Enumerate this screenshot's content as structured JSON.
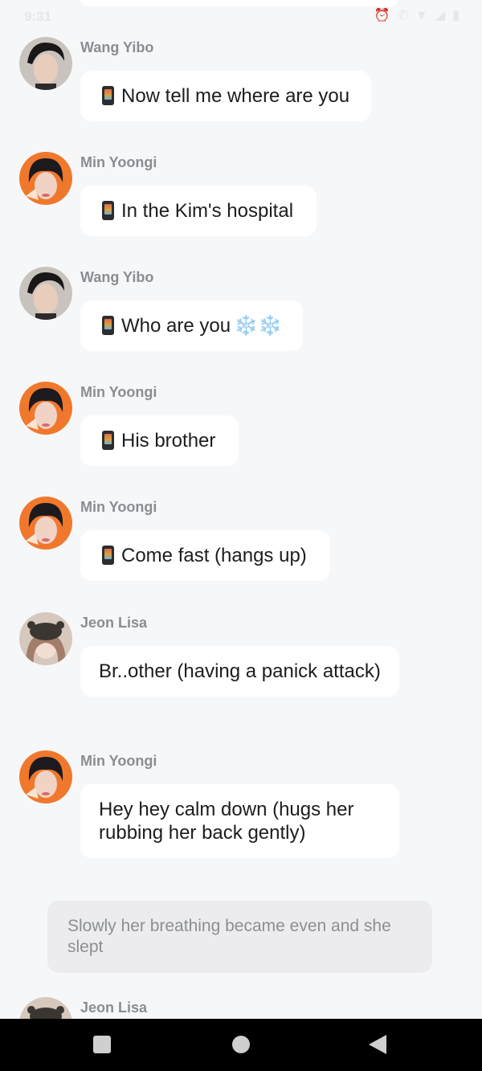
{
  "status_bar": {
    "time": "9:31",
    "icons": [
      "alarm-icon",
      "call-icon",
      "wifi-icon",
      "signal-icon",
      "battery-icon"
    ]
  },
  "messages": [
    {
      "sender": "Wang Yibo",
      "text": "Now tell me where are you",
      "avatar": "wang-yibo",
      "phone_icon": true
    },
    {
      "sender": "Min Yoongi",
      "text": "In the Kim's hospital",
      "avatar": "min-yoongi",
      "phone_icon": true
    },
    {
      "sender": "Wang Yibo",
      "text": "Who are you",
      "avatar": "wang-yibo",
      "phone_icon": true,
      "suffix": "❄️❄️"
    },
    {
      "sender": "Min Yoongi",
      "text": "His brother",
      "avatar": "min-yoongi",
      "phone_icon": true
    },
    {
      "sender": "Min Yoongi",
      "text": "Come fast (hangs up)",
      "avatar": "min-yoongi",
      "phone_icon": true
    },
    {
      "sender": "Jeon Lisa",
      "text": "Br..other (having a panick attack)",
      "avatar": "jeon-lisa",
      "phone_icon": false
    },
    {
      "sender": "Min Yoongi",
      "text": "Hey hey calm down (hugs her rubbing her back gently)",
      "avatar": "min-yoongi",
      "phone_icon": false
    },
    {
      "sender": "Jeon Lisa",
      "text": "",
      "avatar": "jeon-lisa",
      "phone_icon": false
    }
  ],
  "narration": "Slowly her breathing became even and she slept",
  "nav": {
    "buttons": [
      "recents-button",
      "home-button",
      "back-button"
    ]
  },
  "colors": {
    "background": "#f6f7f9",
    "bubble": "#ffffff",
    "narration_bg": "#ececee",
    "sender_text": "#8a8d93",
    "nav_bar": "#000000"
  }
}
